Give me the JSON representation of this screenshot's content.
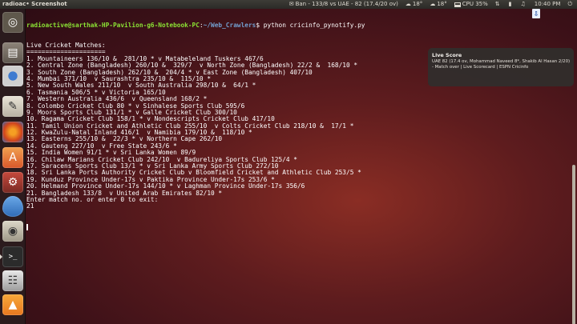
{
  "panel": {
    "app_title": "radioac• Screenshot",
    "indicators": [
      {
        "icon": "chat-icon",
        "text": "Ban - 133/8 vs UAE - 82 (17.4/20 ov)"
      },
      {
        "icon": "weather-icon",
        "text": "18°"
      },
      {
        "icon": "weather-icon",
        "text": "18°"
      },
      {
        "icon": "cpu-icon",
        "text": "CPU 35%"
      },
      {
        "icon": "network-icon",
        "text": ""
      },
      {
        "icon": "battery-icon",
        "text": ""
      },
      {
        "icon": "volume-icon",
        "text": ""
      },
      {
        "icon": "clock-icon",
        "text": "10:40 PM"
      },
      {
        "icon": "power-icon",
        "text": ""
      }
    ]
  },
  "launcher": {
    "items": [
      {
        "name": "home",
        "icon": "ubuntu-logo-icon",
        "glyph": "◎"
      },
      {
        "name": "files",
        "icon": "files-icon",
        "glyph": "▤"
      },
      {
        "name": "chrome",
        "icon": "chrome-icon",
        "glyph": ""
      },
      {
        "name": "editor",
        "icon": "text-editor-icon",
        "glyph": "✎"
      },
      {
        "name": "firefox",
        "icon": "firefox-icon",
        "glyph": ""
      },
      {
        "name": "software",
        "icon": "software-center-icon",
        "glyph": "A"
      },
      {
        "name": "settings",
        "icon": "settings-icon",
        "glyph": "⚙"
      },
      {
        "name": "droplet",
        "icon": "droplet-icon",
        "glyph": ""
      },
      {
        "name": "speaker",
        "icon": "speaker-icon",
        "glyph": "◉"
      },
      {
        "name": "terminal",
        "icon": "terminal-icon",
        "glyph": ">_"
      },
      {
        "name": "remote",
        "icon": "remote-desktop-icon",
        "glyph": "☷"
      },
      {
        "name": "vlc",
        "icon": "vlc-icon",
        "glyph": "▲"
      }
    ]
  },
  "terminal": {
    "prompt_user": "radioactive@sarthak-HP-Pavilion-g6-Notebook-PC",
    "prompt_path": "~/Web_Crawlers",
    "command": "$ python cricinfo_pynotify.py",
    "lines": [
      "Live Cricket Matches:",
      "=====================",
      "1. Mountaineers 136/10 &  281/10 * v Matabeleland Tuskers 467/6",
      "2. Central Zone (Bangladesh) 260/10 &  329/7  v North Zone (Bangladesh) 22/2 &  168/10 *",
      "3. South Zone (Bangladesh) 262/10 &  204/4 * v East Zone (Bangladesh) 407/10",
      "4. Mumbai 371/10  v Saurashtra 235/10 &  115/10 *",
      "5. New South Wales 211/10  v South Australia 298/10 &  64/1 *",
      "6. Tasmania 506/5 * v Victoria 165/10",
      "7. Western Australia 436/6  v Queensland 168/2 *",
      "8. Colombo Cricket Club 80 * v Sinhalese Sports Club 595/6",
      "9. Moors Sports Club 131/1 * v Galle Cricket Club 300/10",
      "10. Ragama Cricket Club 158/1 * v Nondescripts Cricket Club 417/10",
      "11. Tamil Union Cricket and Athletic Club 255/10  v Colts Cricket Club 218/10 &  17/1 *",
      "12. KwaZulu-Natal Inland 416/1  v Namibia 179/10 &  118/10 *",
      "13. Easterns 255/10 &  22/3 * v Northern Cape 262/10",
      "14. Gauteng 227/10  v Free State 243/6 *",
      "15. India Women 91/1 * v Sri Lanka Women 89/9",
      "16. Chilaw Marians Cricket Club 242/10  v Badureliya Sports Club 125/4 *",
      "17. Saracens Sports Club 13/1 * v Sri Lanka Army Sports Club 272/10",
      "18. Sri Lanka Ports Authority Cricket Club v Bloomfield Cricket and Athletic Club 253/5 *",
      "19. Kunduz Province Under-17s v Paktika Province Under-17s 253/6 *",
      "20. Helmand Province Under-17s 144/10 * v Laghman Province Under-17s 356/6",
      "21. Bangladesh 133/8  v United Arab Emirates 82/10 *",
      "Enter match no. or enter 0 to exit:",
      "21"
    ]
  },
  "notification": {
    "title": "Live Score",
    "body": "UAE 82 (17.4 ov, Mohammad Naveed 8*, Shakib Al Hasan 2/20) - Match over | Live Scorecard | ESPN Cricinfo"
  }
}
